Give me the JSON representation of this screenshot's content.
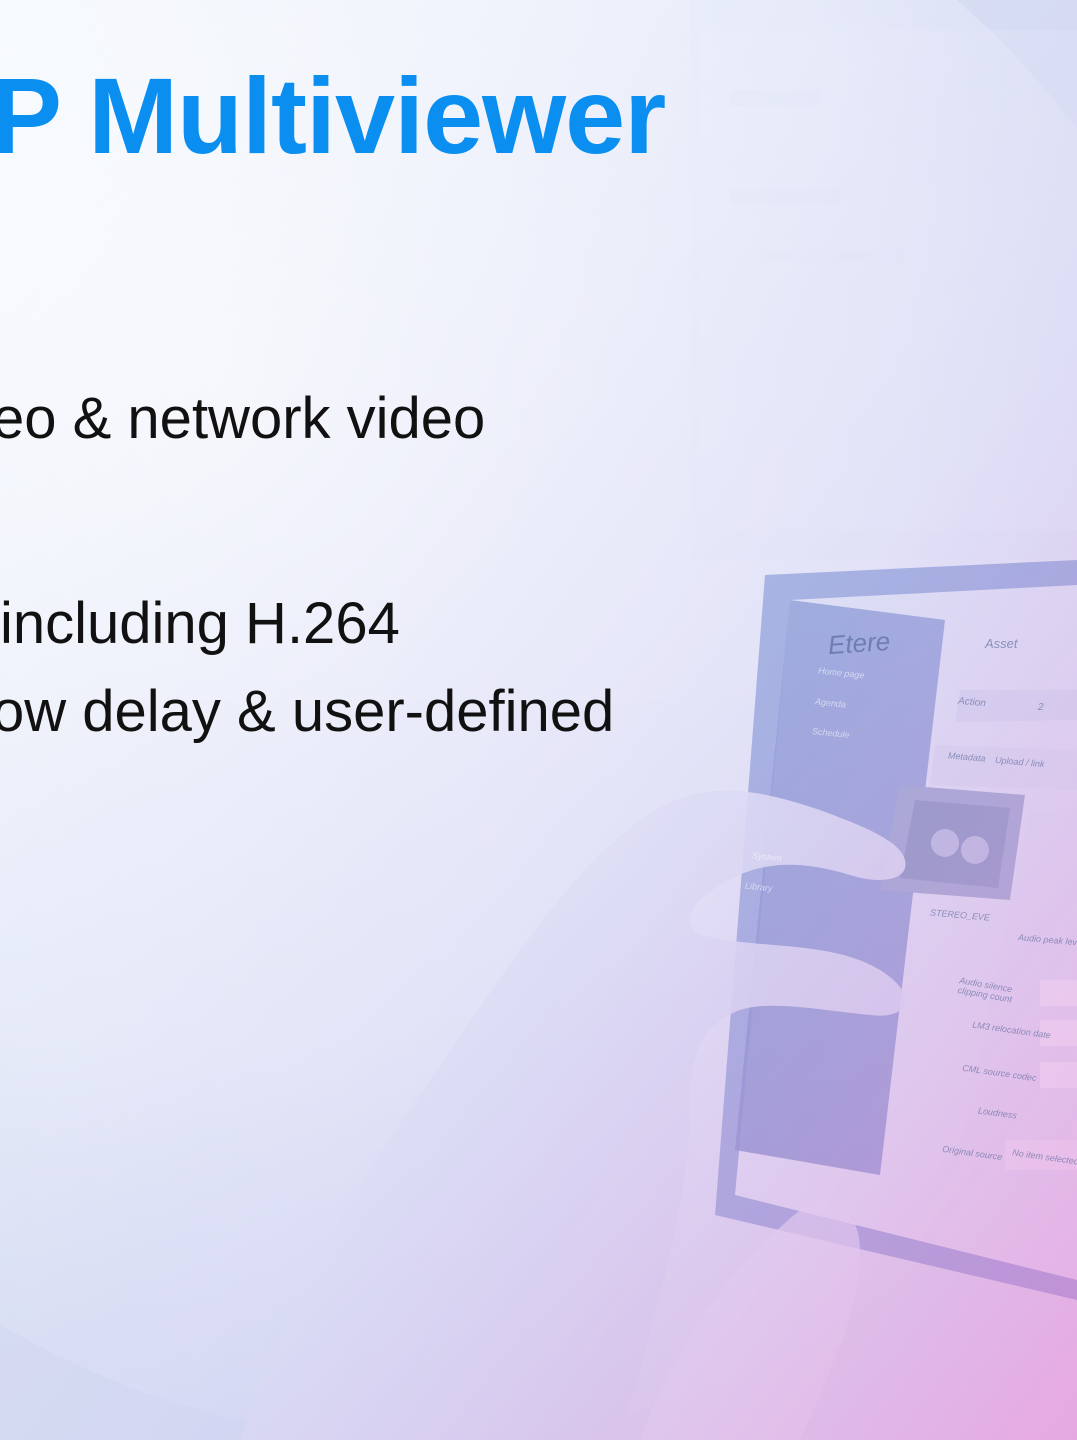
{
  "slide": {
    "title": "P Multiviewer",
    "bullets": [
      "eo & network video",
      " including H.264",
      "ow delay & user-defined"
    ]
  },
  "tablet": {
    "brand": "Etere",
    "header": "Asset",
    "left_menu": [
      "Home page",
      "Agenda",
      "Schedule",
      "System",
      "Library"
    ],
    "toolbar": [
      "Action",
      "2"
    ],
    "tabs": [
      "Metadata",
      "Upload / link"
    ],
    "thumbnail_caption": "STEREO_EVE",
    "field_labels": [
      "Audio peak level",
      "Audio silence clipping count",
      "LM3 relocation date",
      "CML source codec",
      "Loudness",
      "Original source"
    ],
    "original_source_value": "No item selected"
  },
  "colors": {
    "title": "#0a8ff0",
    "text": "#111111",
    "background": "#e9f0f8"
  }
}
